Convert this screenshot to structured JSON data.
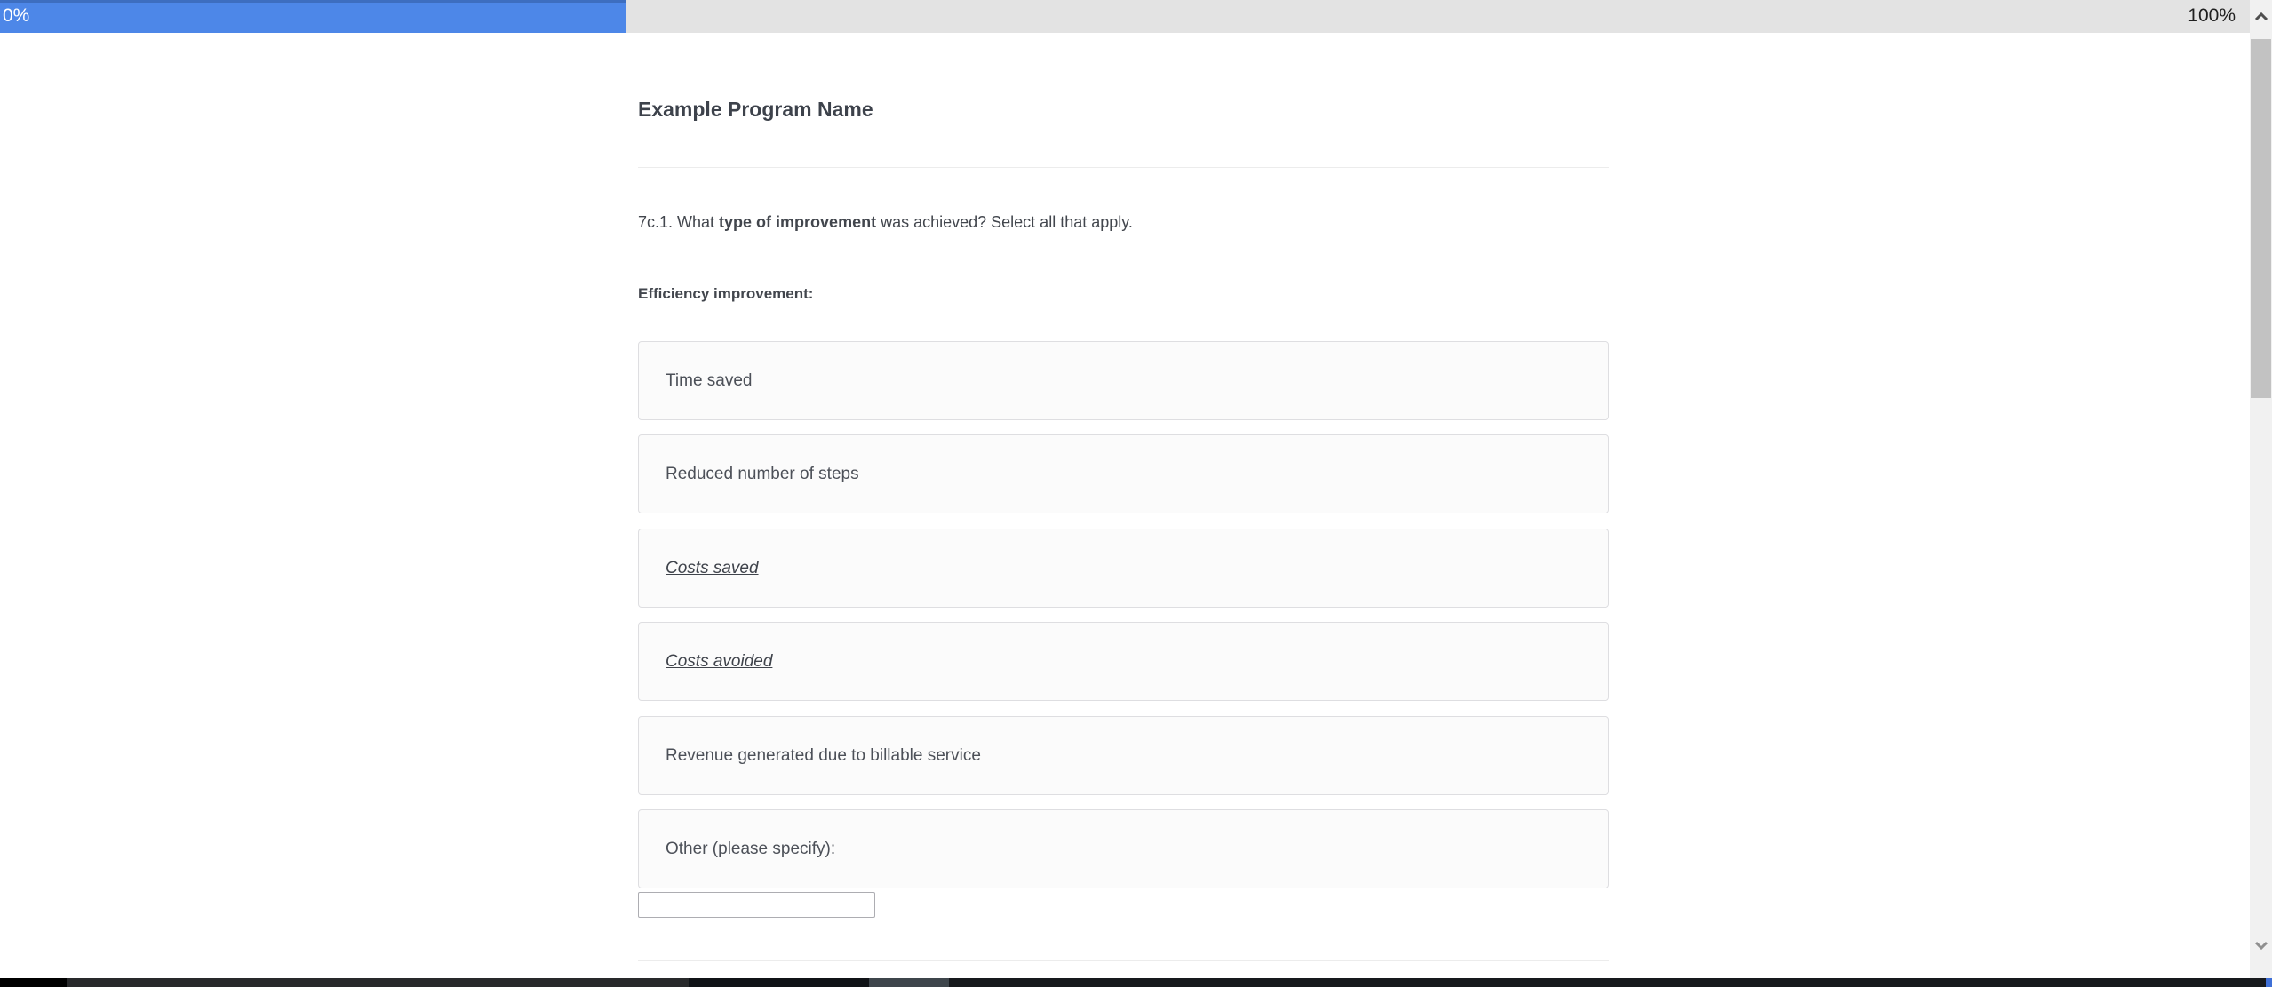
{
  "progress_bar": {
    "current_label": "0%",
    "max_label": "100%",
    "percent_complete": 0,
    "fill_color": "#4d87e8",
    "fill_top_color": "#3d6ec0",
    "track_color": "#e3e3e3"
  },
  "survey": {
    "title": "Example Program Name",
    "question": {
      "prefix": "7c.1. What ",
      "emphasis": "type of improvement",
      "suffix": " was achieved? Select all that apply."
    },
    "section_label": "Efficiency improvement:",
    "options": [
      {
        "label": "Time saved",
        "style": "normal"
      },
      {
        "label": "Reduced number of steps",
        "style": "normal"
      },
      {
        "label": "Costs saved",
        "style": "italic-underline"
      },
      {
        "label": "Costs avoided",
        "style": "italic-underline"
      },
      {
        "label": "Revenue generated due to billable service",
        "style": "normal"
      },
      {
        "label": "Other (please specify):",
        "style": "normal"
      }
    ],
    "other_input": {
      "value": "",
      "placeholder": ""
    }
  },
  "scrollbar": {
    "up_icon": "chevron-up-icon",
    "down_icon": "chevron-down-icon"
  }
}
